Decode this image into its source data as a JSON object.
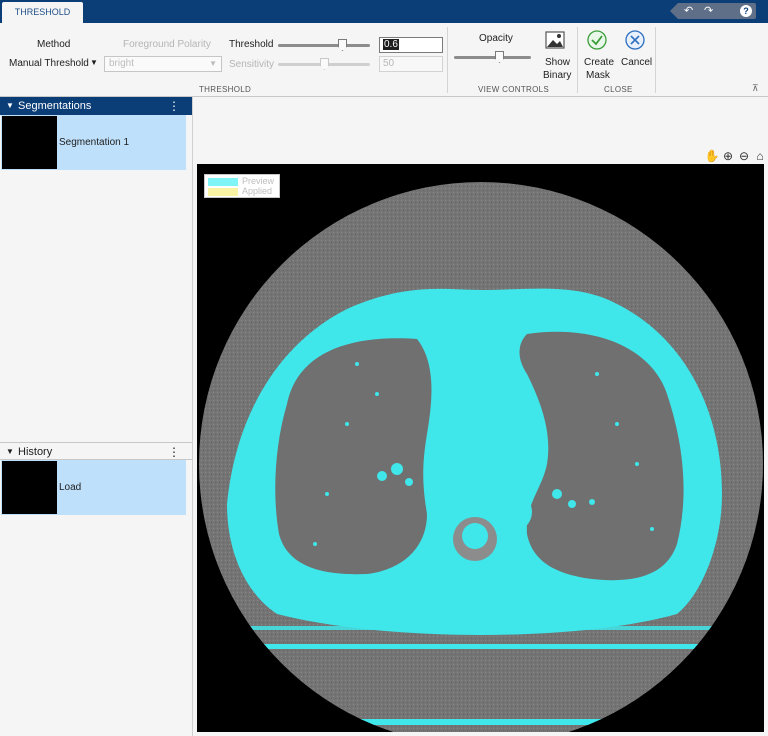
{
  "app": {
    "tab": "THRESHOLD",
    "quick_access": {
      "undo_icon": "undo-icon",
      "redo_icon": "redo-icon",
      "help": "?"
    }
  },
  "ribbon": {
    "method_label": "Method",
    "method_value": "Manual Threshold",
    "polarity_label": "Foreground Polarity",
    "polarity_value": "bright",
    "threshold_label": "Threshold",
    "threshold_value": "0.6",
    "sensitivity_label": "Sensitivity",
    "sensitivity_value": "50",
    "threshold_slider_level": 0.72,
    "sensitivity_slider_level": 0.5,
    "section_threshold": "THRESHOLD",
    "opacity_label": "Opacity",
    "opacity_slider_level": 0.6,
    "show_binary_label_1": "Show",
    "show_binary_label_2": "Binary",
    "section_view": "VIEW CONTROLS",
    "create_mask_label_1": "Create",
    "create_mask_label_2": "Mask",
    "cancel_label": "Cancel",
    "section_close": "CLOSE"
  },
  "segmentations": {
    "header": "Segmentations",
    "items": [
      {
        "label": "Segmentation 1"
      }
    ]
  },
  "history": {
    "header": "History",
    "items": [
      {
        "label": "Load"
      }
    ]
  },
  "axes_toolbar": {
    "icons": [
      "pan-icon",
      "zoom-in-icon",
      "zoom-out-icon",
      "home-icon"
    ]
  },
  "legend": {
    "preview_label": "Preview",
    "applied_label": "Applied",
    "preview_color": "#7ff5f7",
    "applied_color": "#f8f4a3"
  },
  "colors": {
    "accent": "#0b3d77",
    "selection": "#bfe0fb",
    "mask": "#3fe6ea"
  }
}
